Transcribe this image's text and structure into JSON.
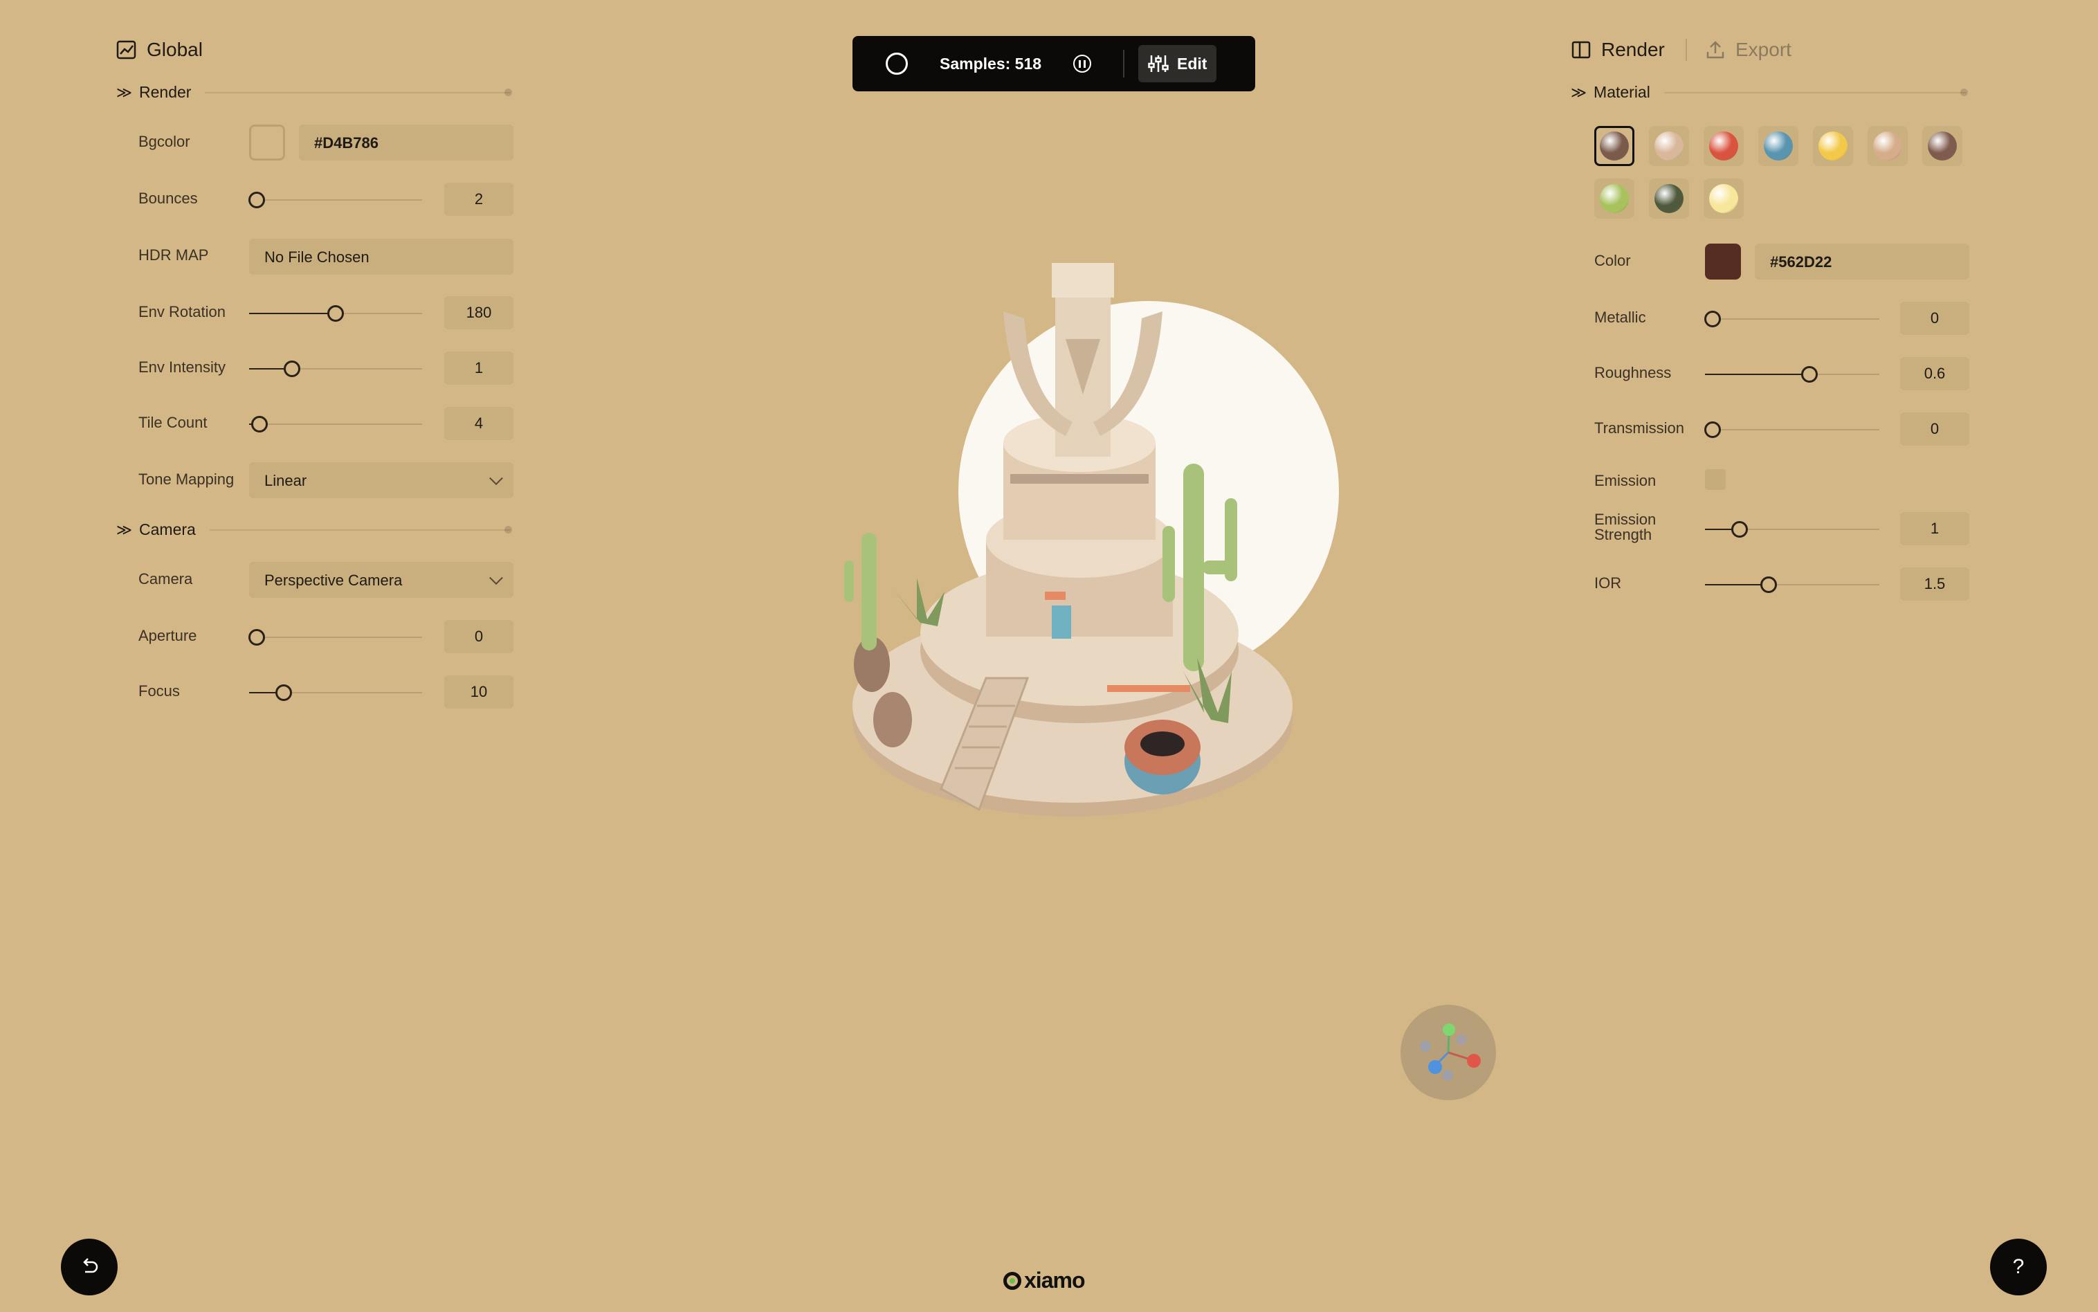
{
  "left_panel": {
    "title": "Global",
    "render_section": "Render",
    "rows": {
      "bgcolor": {
        "label": "Bgcolor",
        "value": "#D4B786"
      },
      "bounces": {
        "label": "Bounces",
        "value": "2",
        "level": 0.0
      },
      "hdr": {
        "label": "HDR MAP",
        "value": "No File Chosen"
      },
      "env_rotation": {
        "label": "Env Rotation",
        "value": "180",
        "level": 0.5
      },
      "env_intensity": {
        "label": "Env Intensity",
        "value": "1",
        "level": 0.25
      },
      "tile_count": {
        "label": "Tile Count",
        "value": "4",
        "level": 0.05
      },
      "tone_mapping": {
        "label": "Tone Mapping",
        "value": "Linear"
      }
    },
    "camera_section": "Camera",
    "camera_rows": {
      "camera": {
        "label": "Camera",
        "value": "Perspective Camera"
      },
      "aperture": {
        "label": "Aperture",
        "value": "0",
        "level": 0.0
      },
      "focus": {
        "label": "Focus",
        "value": "10",
        "level": 0.2
      }
    }
  },
  "toolbar": {
    "samples": "Samples: 518",
    "edit": "Edit"
  },
  "right_panel": {
    "tab_render": "Render",
    "tab_export": "Export",
    "material_section": "Material",
    "swatches": [
      "#7a5a4a",
      "#d9b79a",
      "#d9543f",
      "#5a95b0",
      "#f3c94a",
      "#d6ad8a",
      "#7f5b4e",
      "#a8c25e",
      "#4f5a3c",
      "#f7e79a"
    ],
    "rows": {
      "color": {
        "label": "Color",
        "value": "#562D22"
      },
      "metallic": {
        "label": "Metallic",
        "value": "0",
        "level": 0.0
      },
      "roughness": {
        "label": "Roughness",
        "value": "0.6",
        "level": 0.6
      },
      "transmission": {
        "label": "Transmission",
        "value": "0",
        "level": 0.0
      },
      "emission": {
        "label": "Emission"
      },
      "emission_strength": {
        "label": "Emission\nStrength",
        "value": "1",
        "level": 0.2
      },
      "ior": {
        "label": "IOR",
        "value": "1.5",
        "level": 0.37
      }
    }
  },
  "brand": "xiamo",
  "colors": {
    "background": "#D4B786",
    "material_color": "#562D22"
  }
}
